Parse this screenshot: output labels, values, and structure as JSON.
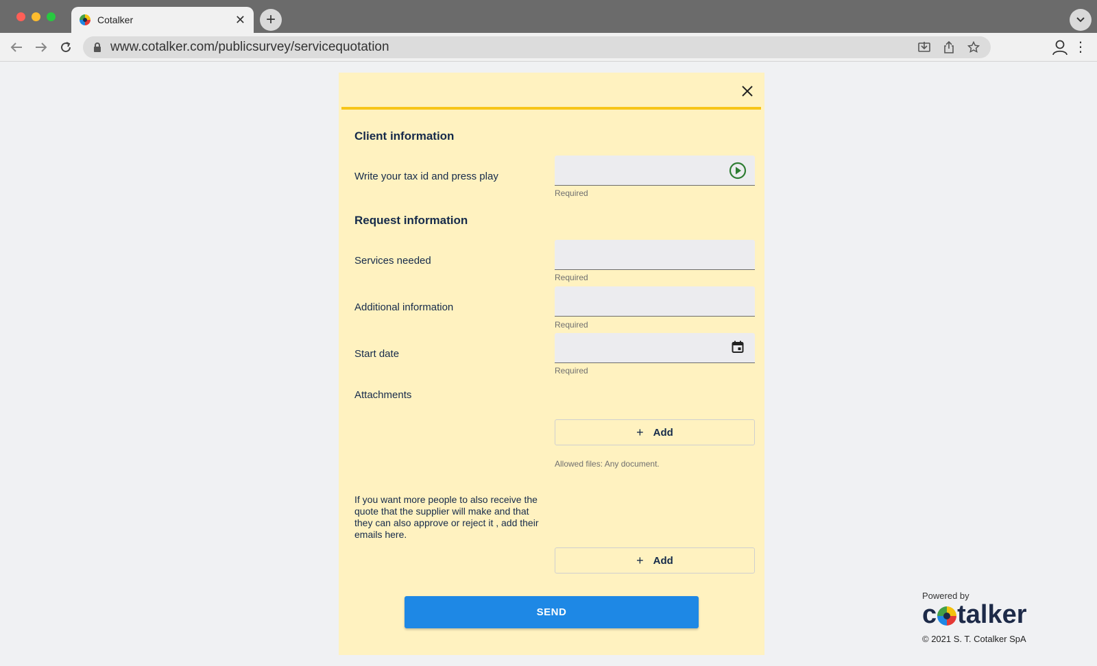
{
  "browser": {
    "tab_title": "Cotalker",
    "url": "www.cotalker.com/publicsurvey/servicequotation"
  },
  "form": {
    "section_client": "Client information",
    "tax_id_label": "Write your tax id and press play",
    "tax_id_value": "",
    "tax_id_hint": "Required",
    "section_request": "Request information",
    "services_label": "Services needed",
    "services_value": "",
    "services_hint": "Required",
    "additional_label": "Additional information",
    "additional_value": "",
    "additional_hint": "Required",
    "start_date_label": "Start date",
    "start_date_value": "",
    "start_date_hint": "Required",
    "attachments_label": "Attachments",
    "attachments_add": "Add",
    "attachments_hint": "Allowed files: Any document.",
    "emails_label": "If you want more people to also receive the quote that the supplier will make and that they can also approve or reject it , add their emails here.",
    "emails_add": "Add",
    "send_label": "SEND"
  },
  "brand": {
    "powered_by": "Powered by",
    "logo_c": "c",
    "logo_rest": "talker",
    "copyright": "© 2021 S. T. Cotalker SpA"
  },
  "colors": {
    "modal_bg": "#fff2c0",
    "accent_bar": "#f7c519",
    "primary_button": "#1e88e5",
    "play_icon": "#2e7d32",
    "heading_text": "#152a4a"
  },
  "icons": {
    "play": "play-circle-icon",
    "calendar": "calendar-icon",
    "close": "close-icon",
    "add": "plus-icon"
  }
}
